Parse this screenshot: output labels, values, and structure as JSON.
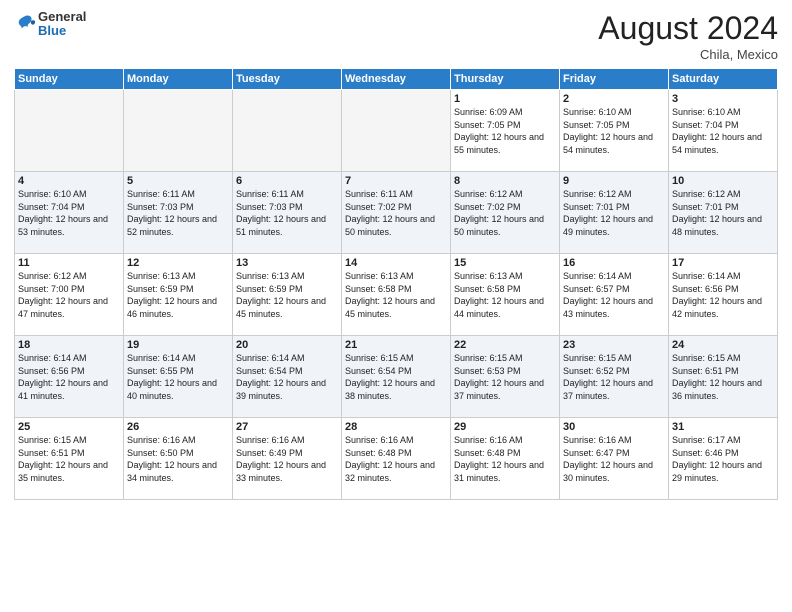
{
  "header": {
    "logo_general": "General",
    "logo_blue": "Blue",
    "month_title": "August 2024",
    "location": "Chila, Mexico"
  },
  "days_of_week": [
    "Sunday",
    "Monday",
    "Tuesday",
    "Wednesday",
    "Thursday",
    "Friday",
    "Saturday"
  ],
  "weeks": [
    [
      {
        "day": "",
        "empty": true
      },
      {
        "day": "",
        "empty": true
      },
      {
        "day": "",
        "empty": true
      },
      {
        "day": "",
        "empty": true
      },
      {
        "day": "1",
        "sunrise": "6:09 AM",
        "sunset": "7:05 PM",
        "daylight": "12 hours and 55 minutes."
      },
      {
        "day": "2",
        "sunrise": "6:10 AM",
        "sunset": "7:05 PM",
        "daylight": "12 hours and 54 minutes."
      },
      {
        "day": "3",
        "sunrise": "6:10 AM",
        "sunset": "7:04 PM",
        "daylight": "12 hours and 54 minutes."
      }
    ],
    [
      {
        "day": "4",
        "sunrise": "6:10 AM",
        "sunset": "7:04 PM",
        "daylight": "12 hours and 53 minutes."
      },
      {
        "day": "5",
        "sunrise": "6:11 AM",
        "sunset": "7:03 PM",
        "daylight": "12 hours and 52 minutes."
      },
      {
        "day": "6",
        "sunrise": "6:11 AM",
        "sunset": "7:03 PM",
        "daylight": "12 hours and 51 minutes."
      },
      {
        "day": "7",
        "sunrise": "6:11 AM",
        "sunset": "7:02 PM",
        "daylight": "12 hours and 50 minutes."
      },
      {
        "day": "8",
        "sunrise": "6:12 AM",
        "sunset": "7:02 PM",
        "daylight": "12 hours and 50 minutes."
      },
      {
        "day": "9",
        "sunrise": "6:12 AM",
        "sunset": "7:01 PM",
        "daylight": "12 hours and 49 minutes."
      },
      {
        "day": "10",
        "sunrise": "6:12 AM",
        "sunset": "7:01 PM",
        "daylight": "12 hours and 48 minutes."
      }
    ],
    [
      {
        "day": "11",
        "sunrise": "6:12 AM",
        "sunset": "7:00 PM",
        "daylight": "12 hours and 47 minutes."
      },
      {
        "day": "12",
        "sunrise": "6:13 AM",
        "sunset": "6:59 PM",
        "daylight": "12 hours and 46 minutes."
      },
      {
        "day": "13",
        "sunrise": "6:13 AM",
        "sunset": "6:59 PM",
        "daylight": "12 hours and 45 minutes."
      },
      {
        "day": "14",
        "sunrise": "6:13 AM",
        "sunset": "6:58 PM",
        "daylight": "12 hours and 45 minutes."
      },
      {
        "day": "15",
        "sunrise": "6:13 AM",
        "sunset": "6:58 PM",
        "daylight": "12 hours and 44 minutes."
      },
      {
        "day": "16",
        "sunrise": "6:14 AM",
        "sunset": "6:57 PM",
        "daylight": "12 hours and 43 minutes."
      },
      {
        "day": "17",
        "sunrise": "6:14 AM",
        "sunset": "6:56 PM",
        "daylight": "12 hours and 42 minutes."
      }
    ],
    [
      {
        "day": "18",
        "sunrise": "6:14 AM",
        "sunset": "6:56 PM",
        "daylight": "12 hours and 41 minutes."
      },
      {
        "day": "19",
        "sunrise": "6:14 AM",
        "sunset": "6:55 PM",
        "daylight": "12 hours and 40 minutes."
      },
      {
        "day": "20",
        "sunrise": "6:14 AM",
        "sunset": "6:54 PM",
        "daylight": "12 hours and 39 minutes."
      },
      {
        "day": "21",
        "sunrise": "6:15 AM",
        "sunset": "6:54 PM",
        "daylight": "12 hours and 38 minutes."
      },
      {
        "day": "22",
        "sunrise": "6:15 AM",
        "sunset": "6:53 PM",
        "daylight": "12 hours and 37 minutes."
      },
      {
        "day": "23",
        "sunrise": "6:15 AM",
        "sunset": "6:52 PM",
        "daylight": "12 hours and 37 minutes."
      },
      {
        "day": "24",
        "sunrise": "6:15 AM",
        "sunset": "6:51 PM",
        "daylight": "12 hours and 36 minutes."
      }
    ],
    [
      {
        "day": "25",
        "sunrise": "6:15 AM",
        "sunset": "6:51 PM",
        "daylight": "12 hours and 35 minutes."
      },
      {
        "day": "26",
        "sunrise": "6:16 AM",
        "sunset": "6:50 PM",
        "daylight": "12 hours and 34 minutes."
      },
      {
        "day": "27",
        "sunrise": "6:16 AM",
        "sunset": "6:49 PM",
        "daylight": "12 hours and 33 minutes."
      },
      {
        "day": "28",
        "sunrise": "6:16 AM",
        "sunset": "6:48 PM",
        "daylight": "12 hours and 32 minutes."
      },
      {
        "day": "29",
        "sunrise": "6:16 AM",
        "sunset": "6:48 PM",
        "daylight": "12 hours and 31 minutes."
      },
      {
        "day": "30",
        "sunrise": "6:16 AM",
        "sunset": "6:47 PM",
        "daylight": "12 hours and 30 minutes."
      },
      {
        "day": "31",
        "sunrise": "6:17 AM",
        "sunset": "6:46 PM",
        "daylight": "12 hours and 29 minutes."
      }
    ]
  ]
}
